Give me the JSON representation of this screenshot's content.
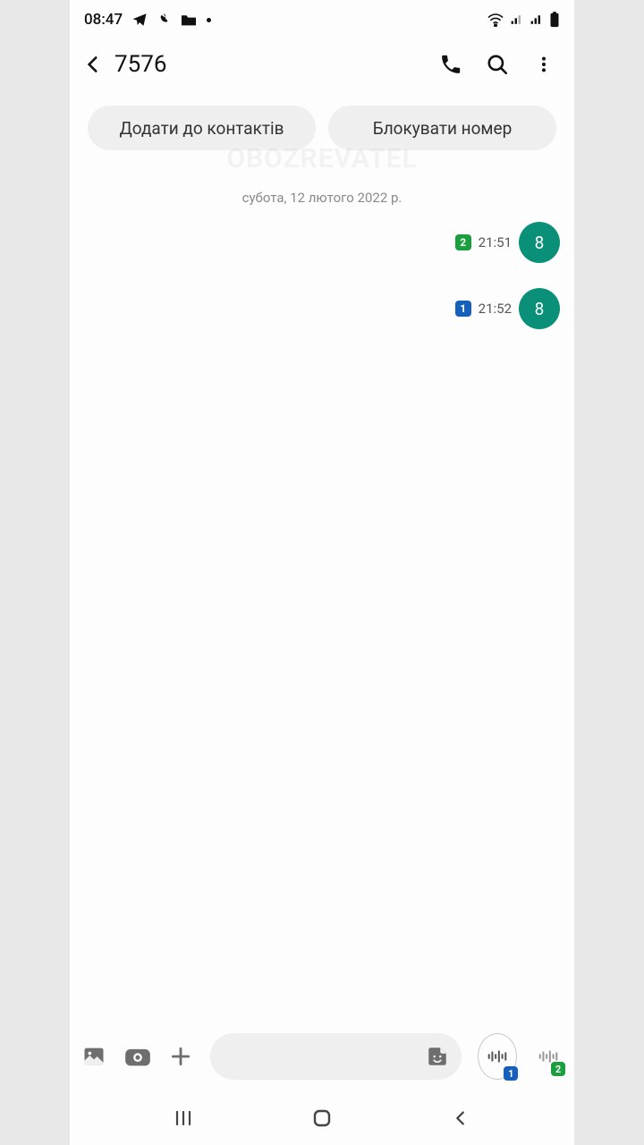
{
  "status": {
    "time": "08:47"
  },
  "header": {
    "title": "7576"
  },
  "chips": {
    "add_contact": "Додати до контактів",
    "block_number": "Блокувати номер"
  },
  "watermark": "OBOZREVATEL",
  "date_divider": "субота, 12 лютого 2022 р.",
  "messages": [
    {
      "sim": "2",
      "sim_color": "green",
      "time": "21:51",
      "bubble": "8"
    },
    {
      "sim": "1",
      "sim_color": "blue",
      "time": "21:52",
      "bubble": "8"
    }
  ],
  "compose": {
    "placeholder": "",
    "voice_sim1": "1",
    "voice_sim2": "2"
  }
}
